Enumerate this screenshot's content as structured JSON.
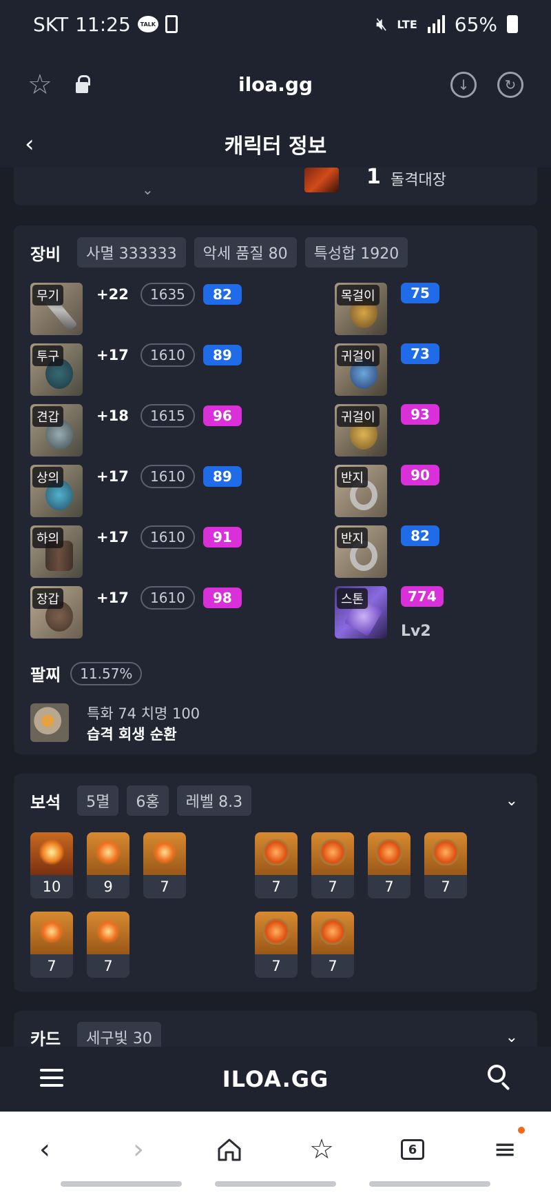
{
  "status_bar": {
    "carrier": "SKT",
    "time": "11:25",
    "talk": "TALK",
    "network": "LTE",
    "battery": "65%"
  },
  "browser": {
    "url": "iloa.gg"
  },
  "page": {
    "back": "‹",
    "title": "캐릭터 정보"
  },
  "top_card": {
    "rank": "1",
    "rank_name": "돌격대장",
    "chevron": "⌄"
  },
  "equipment": {
    "label": "장비",
    "chips": [
      "사멸 333333",
      "악세 품질 80",
      "특성합 1920"
    ],
    "left": [
      {
        "tag": "무기",
        "plus": "+22",
        "ilvl": "1635",
        "quality": "82",
        "q_color": "blue"
      },
      {
        "tag": "투구",
        "plus": "+17",
        "ilvl": "1610",
        "quality": "89",
        "q_color": "blue"
      },
      {
        "tag": "견갑",
        "plus": "+18",
        "ilvl": "1615",
        "quality": "96",
        "q_color": "pink"
      },
      {
        "tag": "상의",
        "plus": "+17",
        "ilvl": "1610",
        "quality": "89",
        "q_color": "blue"
      },
      {
        "tag": "하의",
        "plus": "+17",
        "ilvl": "1610",
        "quality": "91",
        "q_color": "pink"
      },
      {
        "tag": "장갑",
        "plus": "+17",
        "ilvl": "1610",
        "quality": "98",
        "q_color": "pink"
      }
    ],
    "right": [
      {
        "tag": "목걸이",
        "quality": "75",
        "q_color": "blue"
      },
      {
        "tag": "귀걸이",
        "quality": "73",
        "q_color": "blue"
      },
      {
        "tag": "귀걸이",
        "quality": "93",
        "q_color": "pink"
      },
      {
        "tag": "반지",
        "quality": "90",
        "q_color": "pink"
      },
      {
        "tag": "반지",
        "quality": "82",
        "q_color": "blue"
      },
      {
        "tag": "스톤",
        "quality": "774",
        "q_color": "pink"
      }
    ],
    "stone_level": "Lv2",
    "bracelet": {
      "label": "팔찌",
      "percent": "11.57%",
      "stats": "특화 74  치명 100",
      "effects": "습격  회생  순환"
    }
  },
  "gems": {
    "label": "보석",
    "chips": [
      "5멸",
      "6홍",
      "레벨 8.3"
    ],
    "toggle": "⌄",
    "row1_left": [
      "10",
      "9",
      "7"
    ],
    "row1_right": [
      "7",
      "7",
      "7",
      "7"
    ],
    "row2_left": [
      "7",
      "7"
    ],
    "row2_right": [
      "7",
      "7"
    ]
  },
  "cards": {
    "label": "카드",
    "chip": "세구빛 30",
    "toggle": "⌄"
  },
  "site_nav": {
    "logo": "ILOA.GG"
  },
  "browser_bar": {
    "tabs": "6"
  },
  "colors": {
    "blue_quality": "#1f6be8",
    "pink_quality": "#d930d9",
    "background": "#1b1e27",
    "card": "#222632"
  }
}
